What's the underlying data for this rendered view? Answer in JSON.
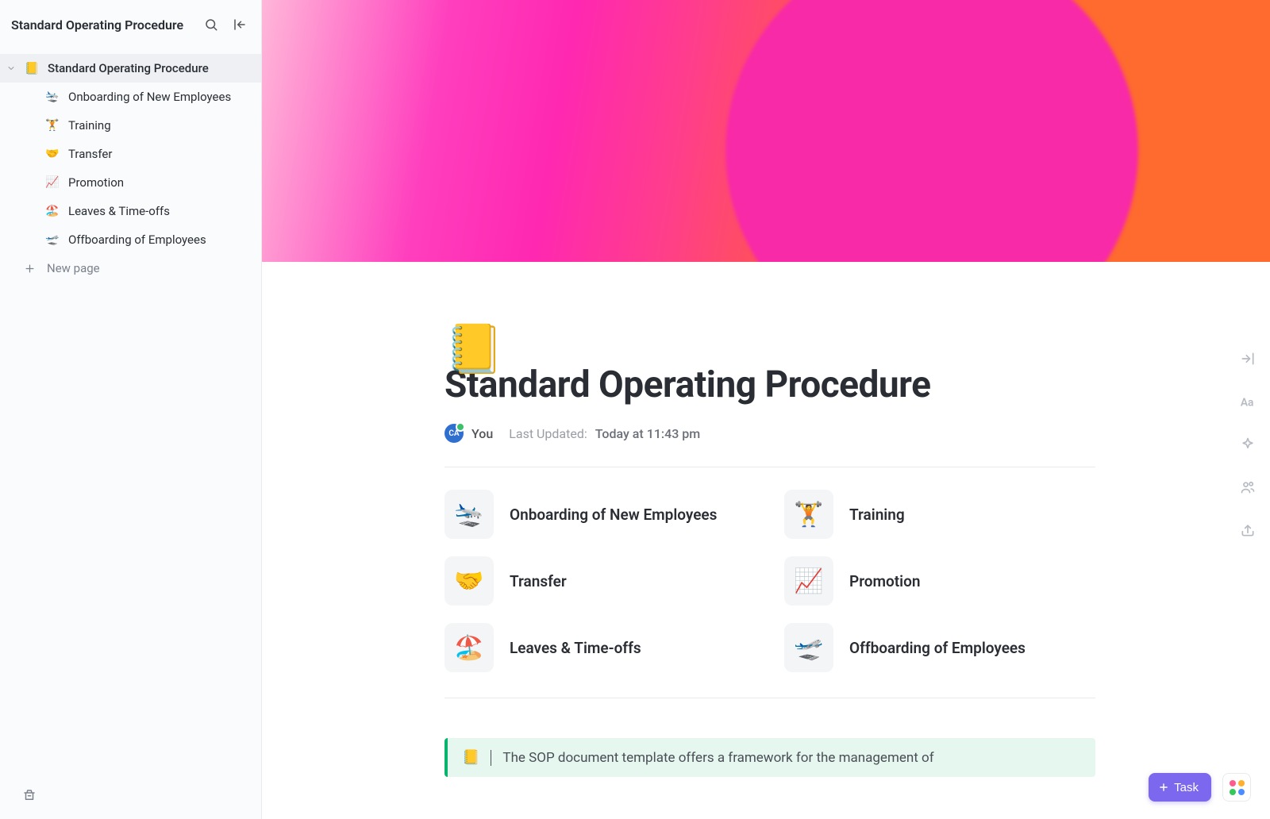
{
  "sidebar": {
    "title": "Standard Operating Procedure",
    "root": {
      "emoji": "📒",
      "label": "Standard Operating Procedure"
    },
    "children": [
      {
        "emoji": "🛬",
        "label": "Onboarding of New Employees"
      },
      {
        "emoji": "🏋️",
        "label": "Training"
      },
      {
        "emoji": "🤝",
        "label": "Transfer"
      },
      {
        "emoji": "📈",
        "label": "Promotion"
      },
      {
        "emoji": "🏖️",
        "label": "Leaves & Time-offs"
      },
      {
        "emoji": "🛫",
        "label": "Offboarding of Employees"
      }
    ],
    "new_page": "New page"
  },
  "page": {
    "icon": "📒",
    "title": "Standard Operating Procedure",
    "meta": {
      "avatar_initials": "CA",
      "you": "You",
      "last_updated_label": "Last Updated:",
      "last_updated_value": "Today at 11:43 pm"
    },
    "cards": [
      {
        "emoji": "🛬",
        "label": "Onboarding of New Employees"
      },
      {
        "emoji": "🏋️",
        "label": "Training"
      },
      {
        "emoji": "🤝",
        "label": "Transfer"
      },
      {
        "emoji": "📈",
        "label": "Promotion"
      },
      {
        "emoji": "🏖️",
        "label": "Leaves & Time-offs"
      },
      {
        "emoji": "🛫",
        "label": "Offboarding of Employees"
      }
    ],
    "callout": {
      "emoji": "📒",
      "text": "The SOP document template offers a framework for the management of"
    }
  },
  "floating": {
    "task_label": "Task"
  }
}
